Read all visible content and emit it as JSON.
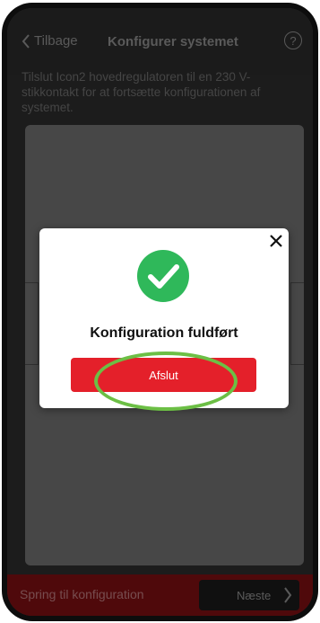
{
  "header": {
    "back_label": "Tilbage",
    "title": "Konfigurer systemet",
    "help_symbol": "?"
  },
  "instruction": "Tilslut Icon2 hovedregulatoren til en 230 V-stikkontakt for at fortsætte konfigurationen af systemet.",
  "modal": {
    "title": "Konfiguration fuldført",
    "button_label": "Afslut",
    "icon": "check-circle-icon",
    "accent_color": "#e4202a",
    "success_color": "#2fb85a"
  },
  "footer": {
    "skip_label": "Spring til konfiguration",
    "next_label": "Næste"
  },
  "annotation": {
    "ring_color": "#6cbf45"
  }
}
